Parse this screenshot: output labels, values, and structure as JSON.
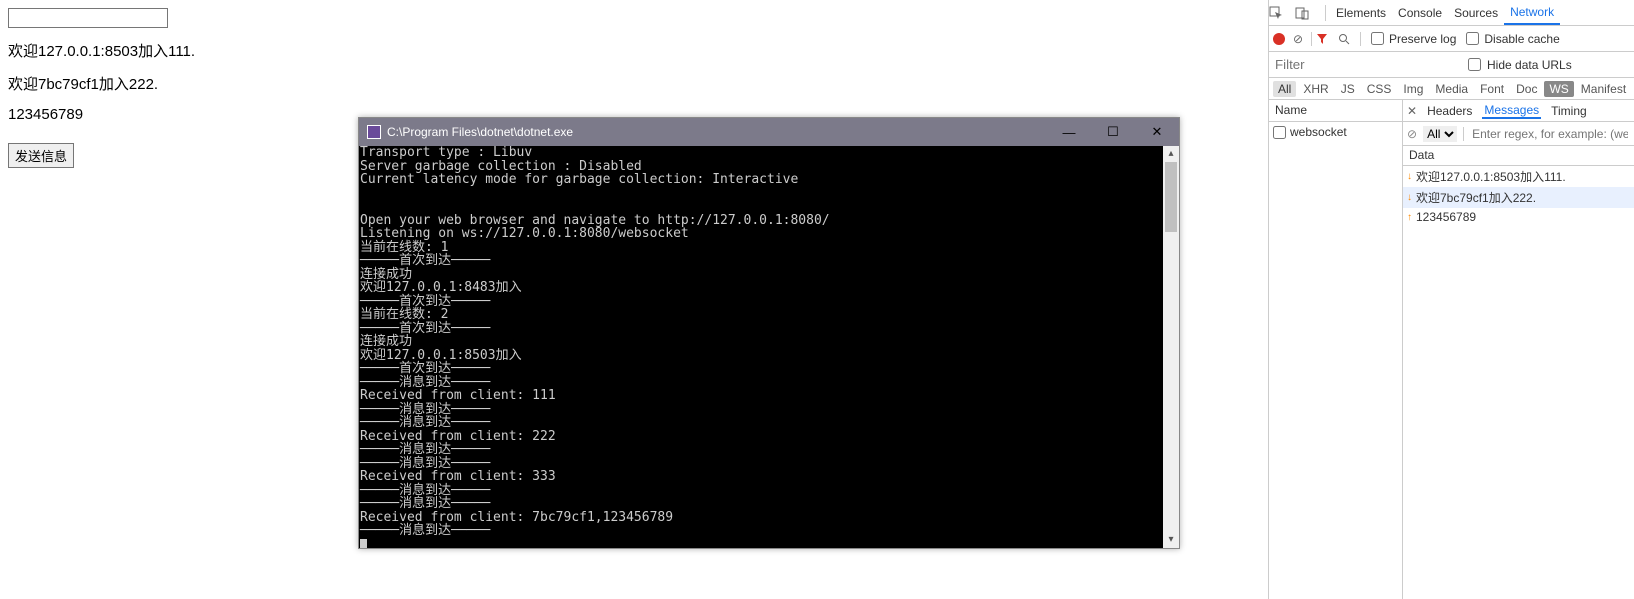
{
  "page": {
    "input_value": "",
    "messages": [
      "欢迎127.0.0.1:8503加入111.",
      "欢迎7bc79cf1加入222.",
      "123456789"
    ],
    "send_button": "发送信息"
  },
  "console": {
    "title": "C:\\Program Files\\dotnet\\dotnet.exe",
    "lines": [
      "Transport type : Libuv",
      "Server garbage collection : Disabled",
      "Current latency mode for garbage collection: Interactive",
      "",
      "",
      "Open your web browser and navigate to http://127.0.0.1:8080/",
      "Listening on ws://127.0.0.1:8080/websocket",
      "当前在线数: 1",
      "─────首次到达─────",
      "连接成功",
      "欢迎127.0.0.1:8483加入",
      "─────首次到达─────",
      "当前在线数: 2",
      "─────首次到达─────",
      "连接成功",
      "欢迎127.0.0.1:8503加入",
      "─────首次到达─────",
      "─────消息到达─────",
      "Received from client: 111",
      "─────消息到达─────",
      "─────消息到达─────",
      "Received from client: 222",
      "─────消息到达─────",
      "─────消息到达─────",
      "Received from client: 333",
      "─────消息到达─────",
      "─────消息到达─────",
      "Received from client: 7bc79cf1,123456789",
      "─────消息到达─────"
    ]
  },
  "devtools": {
    "tabs": {
      "elements": "Elements",
      "console": "Console",
      "sources": "Sources",
      "network": "Network"
    },
    "toolbar": {
      "preserve_log": "Preserve log",
      "disable_cache": "Disable cache"
    },
    "filter": {
      "placeholder": "Filter",
      "hide_data_urls": "Hide data URLs"
    },
    "type_filters": [
      "All",
      "XHR",
      "JS",
      "CSS",
      "Img",
      "Media",
      "Font",
      "Doc",
      "WS",
      "Manifest"
    ],
    "reqcol": {
      "header": "Name",
      "rows": [
        "websocket"
      ]
    },
    "detail_tabs": {
      "headers": "Headers",
      "messages": "Messages",
      "timing": "Timing"
    },
    "msgfilter": {
      "all": "All",
      "placeholder": "Enter regex, for example: (web)?socket"
    },
    "data_header": "Data",
    "messages": [
      {
        "text": "欢迎127.0.0.1:8503加入111.",
        "dir": "↓"
      },
      {
        "text": "欢迎7bc79cf1加入222.",
        "dir": "↓"
      },
      {
        "text": "123456789",
        "dir": "↑"
      }
    ],
    "selected_message_index": 1
  }
}
